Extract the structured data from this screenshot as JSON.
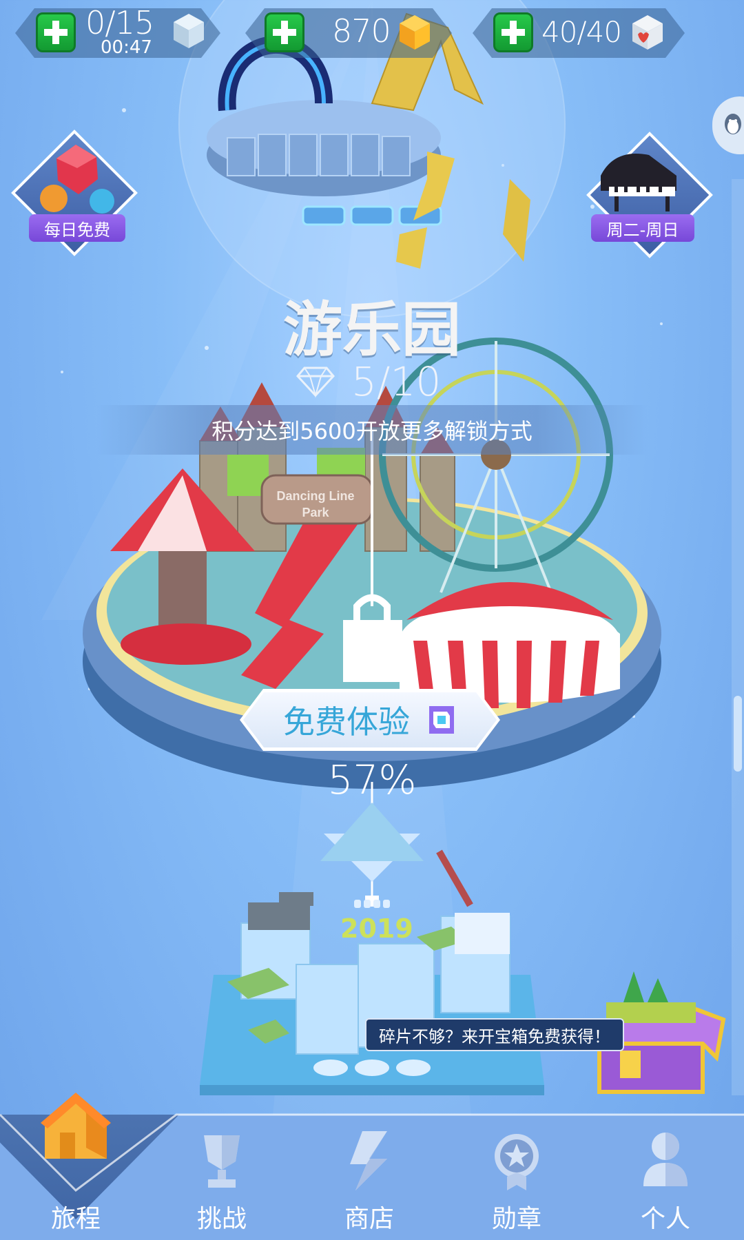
{
  "top_bar": {
    "energy": {
      "value": "0/15",
      "timer": "00:47",
      "icon": "ice-cube-icon"
    },
    "gems": {
      "value": "870",
      "icon": "gold-gem-icon"
    },
    "hearts": {
      "value": "40/40",
      "icon": "heart-cube-icon"
    }
  },
  "side_badges": {
    "left": {
      "label": "每日免费",
      "icon": "balloons-icon"
    },
    "right": {
      "label": "周二-周日",
      "icon": "piano-icon"
    }
  },
  "level": {
    "title": "游乐园",
    "gem_progress": "5/10",
    "unlock_hint": "积分达到5600开放更多解锁方式",
    "park_sign_line1": "Dancing Line",
    "park_sign_line2": "Park",
    "free_trial_label": "免费体验",
    "percent": "57%"
  },
  "next_level": {
    "year": "2019"
  },
  "chest_tip": "碎片不够？来开宝箱免费获得！",
  "nav": {
    "items": [
      {
        "label": "旅程",
        "icon": "house-icon",
        "active": true
      },
      {
        "label": "挑战",
        "icon": "trophy-icon",
        "active": false
      },
      {
        "label": "商店",
        "icon": "shop-s-icon",
        "active": false
      },
      {
        "label": "勋章",
        "icon": "medal-icon",
        "active": false
      },
      {
        "label": "个人",
        "icon": "person-icon",
        "active": false
      }
    ]
  },
  "colors": {
    "accent_green": "#27c94a",
    "badge_purple": "#8a5ae6",
    "nav_blue": "#4468a8",
    "trial_text": "#36a6d8"
  }
}
